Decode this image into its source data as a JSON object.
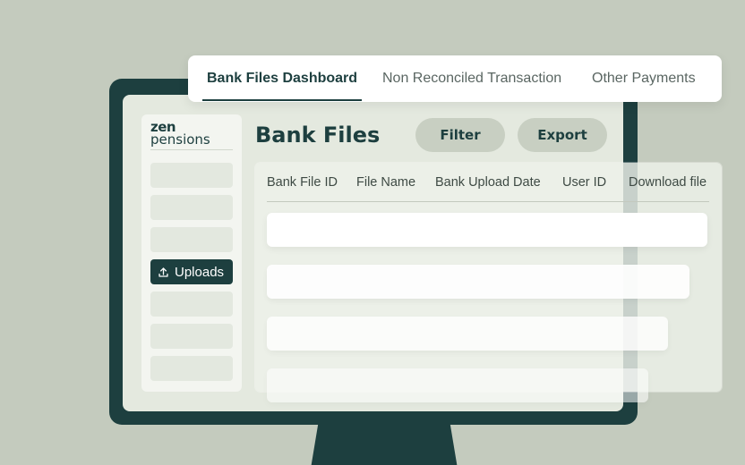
{
  "tabs": [
    {
      "label": "Bank Files Dashboard",
      "active": true
    },
    {
      "label": "Non Reconciled Transaction",
      "active": false
    },
    {
      "label": "Other Payments",
      "active": false
    }
  ],
  "logo": {
    "line1": "zen",
    "line2": "pensions"
  },
  "sidebar": {
    "active_item": {
      "label": "Uploads",
      "icon": "upload-icon"
    }
  },
  "page": {
    "title": "Bank Files"
  },
  "toolbar": {
    "filter_label": "Filter",
    "export_label": "Export"
  },
  "table": {
    "columns": [
      "Bank File ID",
      "File Name",
      "Bank Upload Date",
      "User ID",
      "Download file"
    ]
  },
  "colors": {
    "background": "#c4cbbe",
    "brand": "#1d3f3f",
    "screen": "#e4e9df",
    "button": "#c8cfc2"
  }
}
